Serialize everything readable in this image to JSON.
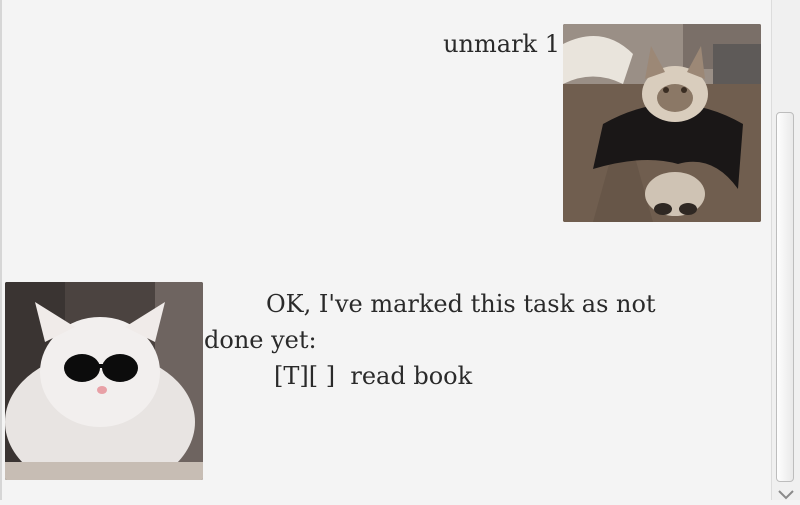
{
  "conversation": {
    "user_message": "unmark 1",
    "bot_message": {
      "line1": "OK, I've marked this task as not done yet:",
      "task": "[T][ ]  read book"
    }
  },
  "avatars": {
    "user": "siamese-cat-cape-avatar",
    "bot": "white-cat-sunglasses-avatar"
  },
  "colors": {
    "background": "#f4f4f4",
    "text": "#2a2a2a"
  }
}
